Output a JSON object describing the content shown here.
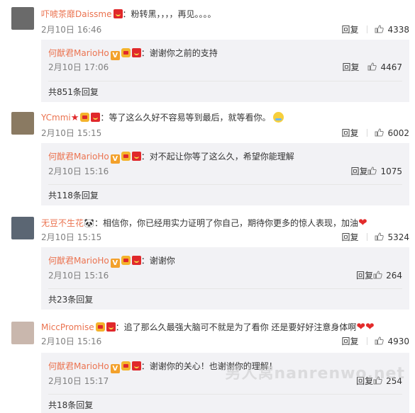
{
  "threads": [
    {
      "user": "吓唬茶靡Daissme",
      "text": "粉转黑，，，，再见。。。。",
      "date": "2月10日 16:46",
      "reply_label": "回复",
      "likes": "4338",
      "avatar_color": "#6a6a6a",
      "sub": {
        "user": "何猷君MarioHo",
        "text": "谢谢你之前的支持",
        "date": "2月10日 17:06",
        "reply_label": "回复",
        "likes": "4467",
        "count": "共851条回复"
      }
    },
    {
      "user": "YCmmi",
      "text": "等了这么久好不容易等到最后，就等看你。",
      "date": "2月10日 15:15",
      "reply_label": "回复",
      "likes": "6002",
      "avatar_color": "#8a7a62",
      "sub": {
        "user": "何猷君MarioHo",
        "text": "对不起让你等了这么久，希望你能理解",
        "date": "2月10日 15:16",
        "reply_label": "回复",
        "likes": "1075",
        "count": "共118条回复"
      }
    },
    {
      "user": "无豆不生花",
      "text": "相信你，你已经用实力证明了你自己，期待你更多的惊人表现，加油",
      "date": "2月10日 15:15",
      "reply_label": "回复",
      "likes": "5324",
      "avatar_color": "#5b6673",
      "sub": {
        "user": "何猷君MarioHo",
        "text": "谢谢你",
        "date": "2月10日 15:16",
        "reply_label": "回复",
        "likes": "264",
        "count": "共23条回复"
      }
    },
    {
      "user": "MiccPromise",
      "text": "追了那么久最强大脑可不就是为了看你 还是要好好注意身体啊",
      "date": "2月10日 15:16",
      "reply_label": "回复",
      "likes": "4930",
      "avatar_color": "#c9b7ad",
      "sub": {
        "user": "何猷君MarioHo",
        "text": "谢谢你的关心！也谢谢你的理解！",
        "date": "2月10日 15:17",
        "reply_label": "回复",
        "likes": "254",
        "count": "共18条回复"
      }
    }
  ],
  "watermark": "男人窝nanrenwo.net",
  "colors": {
    "username": "#eb7350",
    "sub_bg": "#f2f2f5",
    "date": "#808080"
  }
}
